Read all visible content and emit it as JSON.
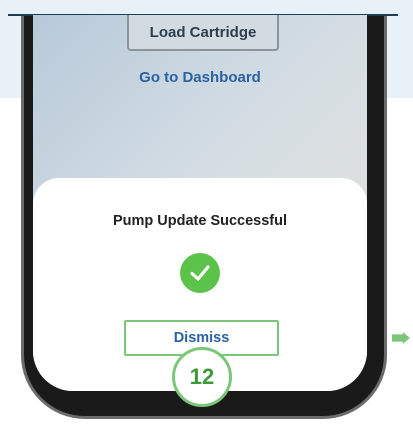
{
  "screen": {
    "load_button": "Load Cartridge",
    "dashboard_link": "Go to Dashboard"
  },
  "dialog": {
    "title": "Pump Update Successful",
    "status_icon": "checkmark-circle-icon",
    "dismiss_button": "Dismiss"
  },
  "step_badge": "12",
  "colors": {
    "accent_green": "#5bc24a",
    "callout_green": "#7cc67a",
    "link_blue": "#2b62a3",
    "phone_frame": "#1a1a1a"
  }
}
